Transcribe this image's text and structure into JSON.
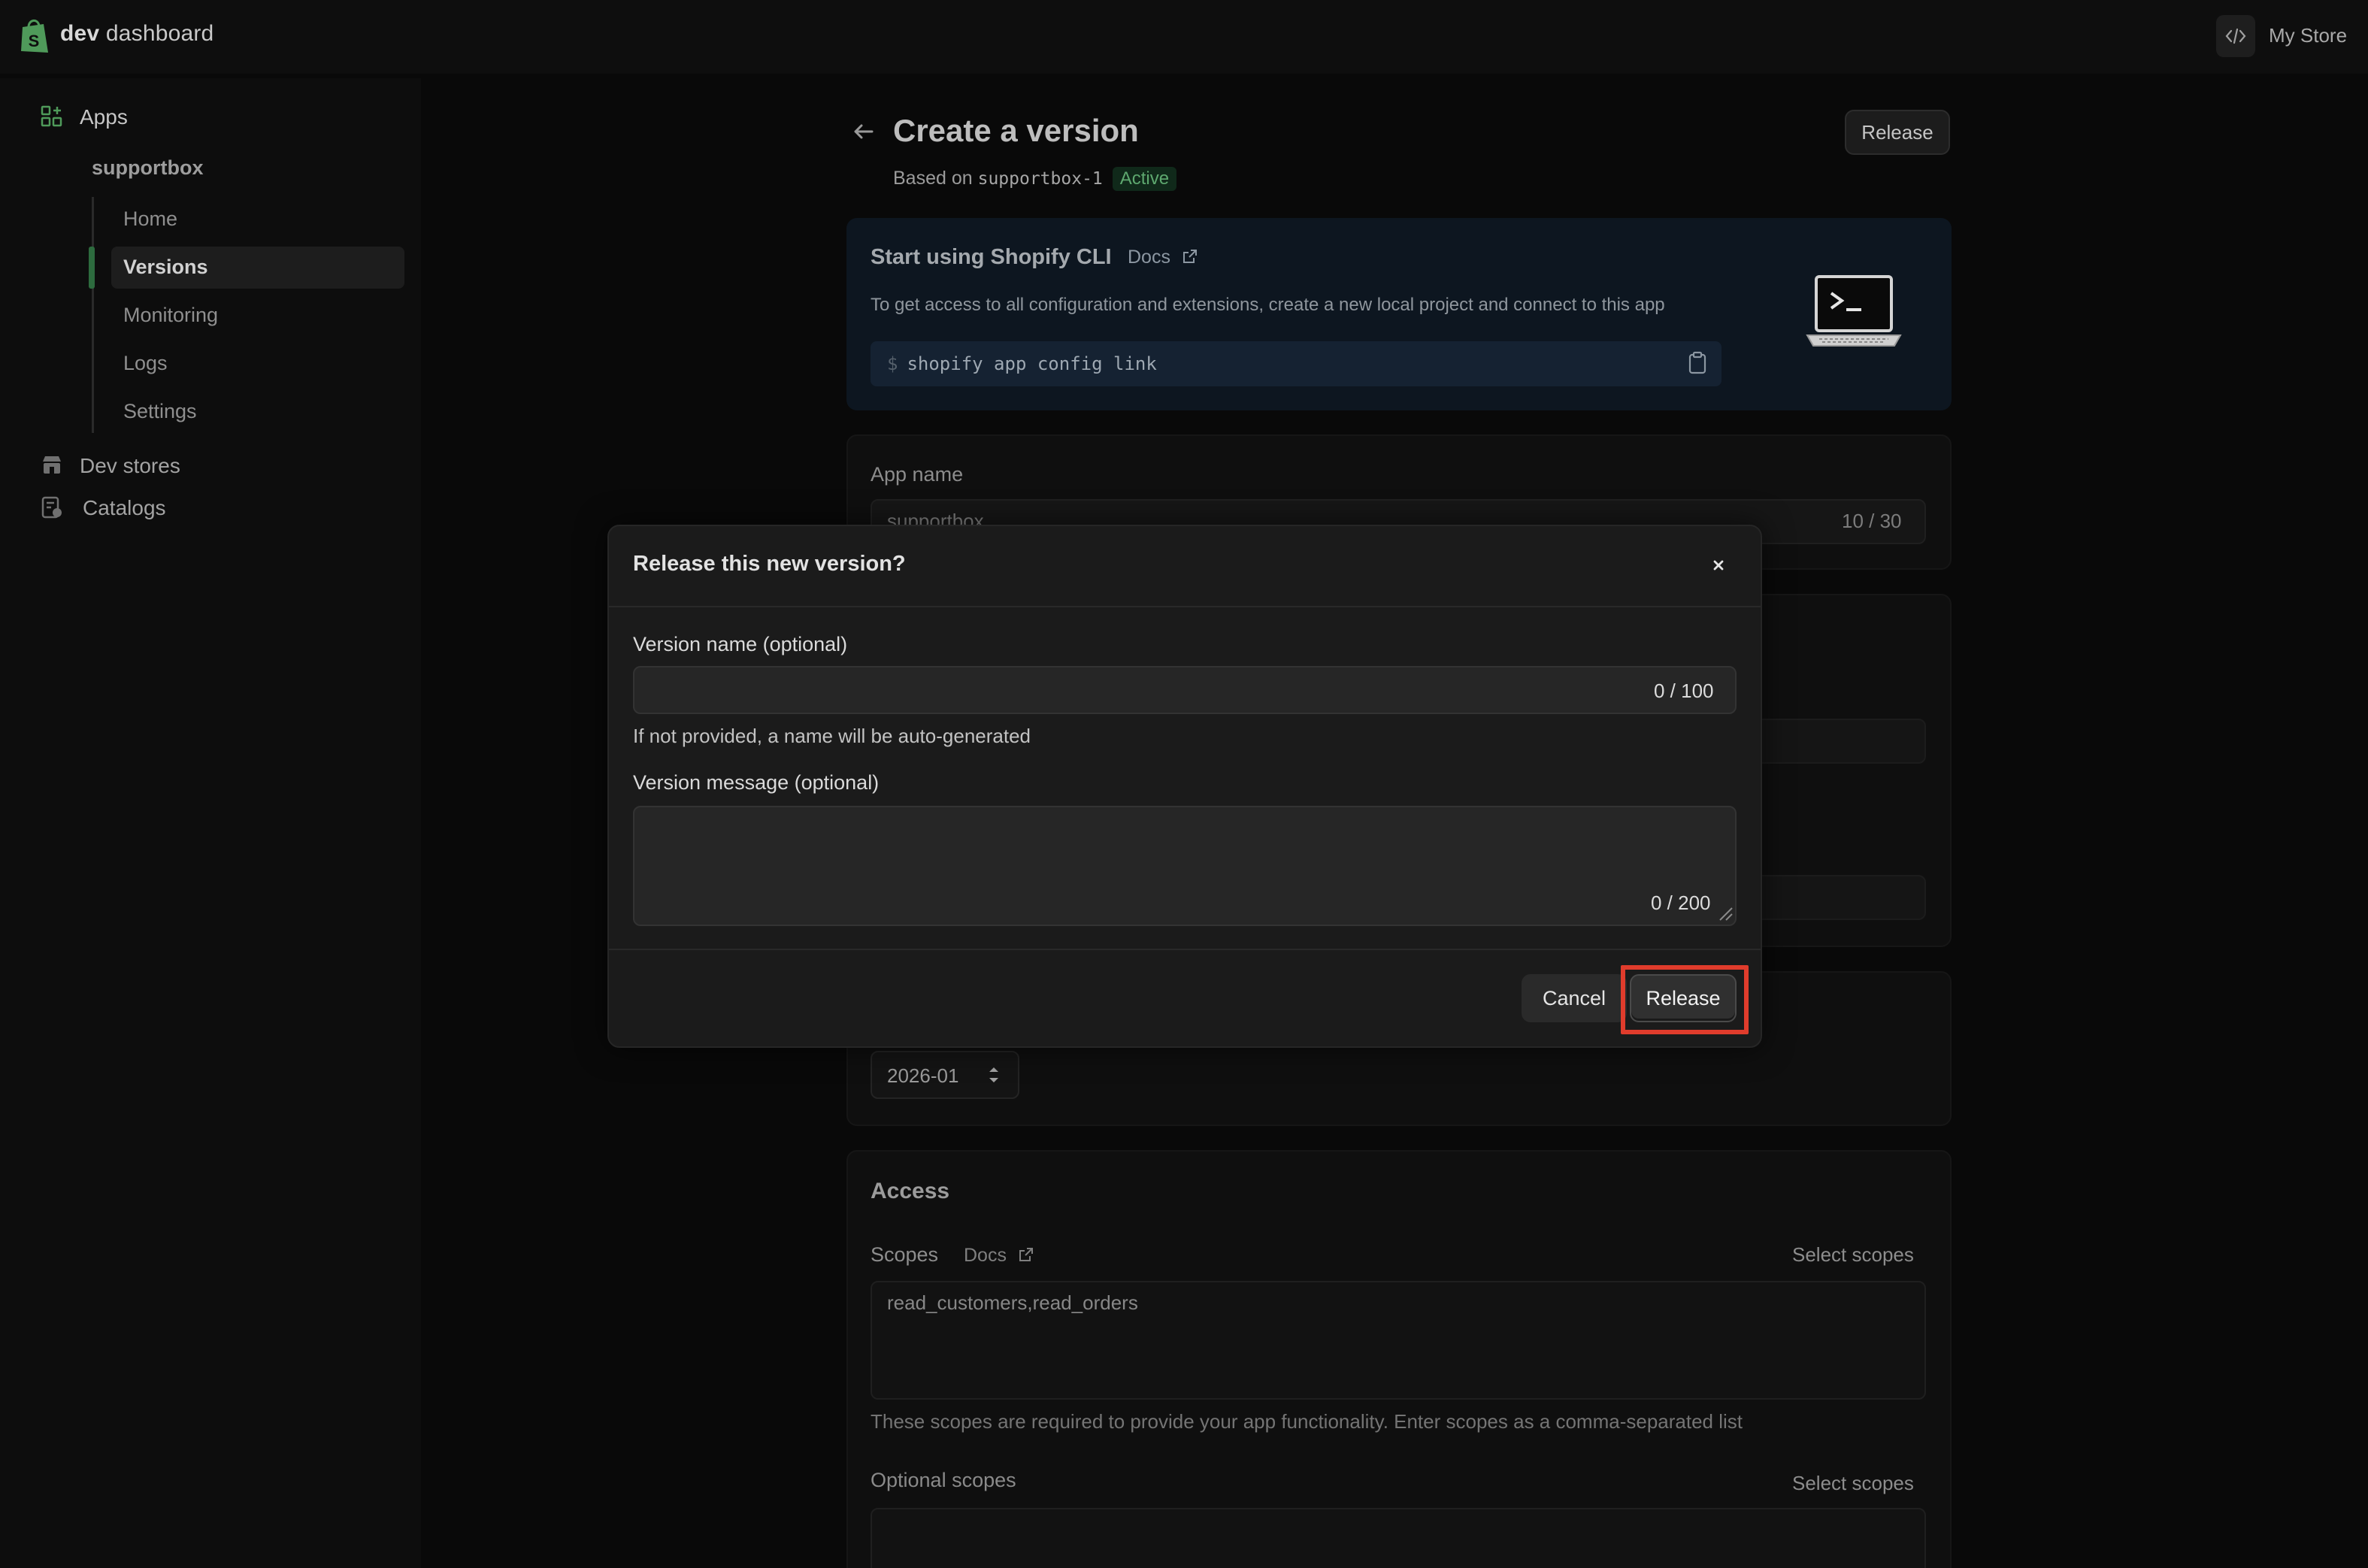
{
  "topbar": {
    "brand_bold": "dev",
    "brand_rest": "dashboard",
    "store_name": "My Store",
    "icons": {
      "logo": "shopify-bag-icon",
      "code": "code-icon"
    }
  },
  "sidebar": {
    "apps_label": "Apps",
    "app_name": "supportbox",
    "sub_items": [
      "Home",
      "Versions",
      "Monitoring",
      "Logs",
      "Settings"
    ],
    "active_item": "Versions",
    "dev_stores": "Dev stores",
    "catalogs": "Catalogs",
    "accent_color": "#2d6b3e"
  },
  "header": {
    "title": "Create a version",
    "based_on_prefix": "Based on",
    "based_on_version": "supportbox-1",
    "status_badge": "Active",
    "release_button": "Release"
  },
  "cli_card": {
    "title": "Start using Shopify CLI",
    "docs_link": "Docs",
    "description": "To get access to all configuration and extensions, create a new local project and connect to this app",
    "prompt": "$",
    "command": "shopify app config link"
  },
  "app_card": {
    "label": "App name",
    "value": "supportbox",
    "count": "10 / 30"
  },
  "api_card": {
    "version_value": "2026-01"
  },
  "access_card": {
    "title": "Access",
    "scopes_label": "Scopes",
    "docs_link": "Docs",
    "select_scopes": "Select scopes",
    "scopes_value": "read_customers,read_orders",
    "scopes_help": "These scopes are required to provide your app functionality. Enter scopes as a comma-separated list",
    "optional_scopes_label": "Optional scopes",
    "optional_select_scopes": "Select scopes"
  },
  "modal": {
    "title": "Release this new version?",
    "version_name_label": "Version name (optional)",
    "version_name_count": "0 / 100",
    "version_name_help": "If not provided, a name will be auto-generated",
    "version_message_label": "Version message (optional)",
    "version_message_count": "0 / 200",
    "cancel_button": "Cancel",
    "release_button": "Release",
    "highlight_color": "#e03c2c"
  }
}
